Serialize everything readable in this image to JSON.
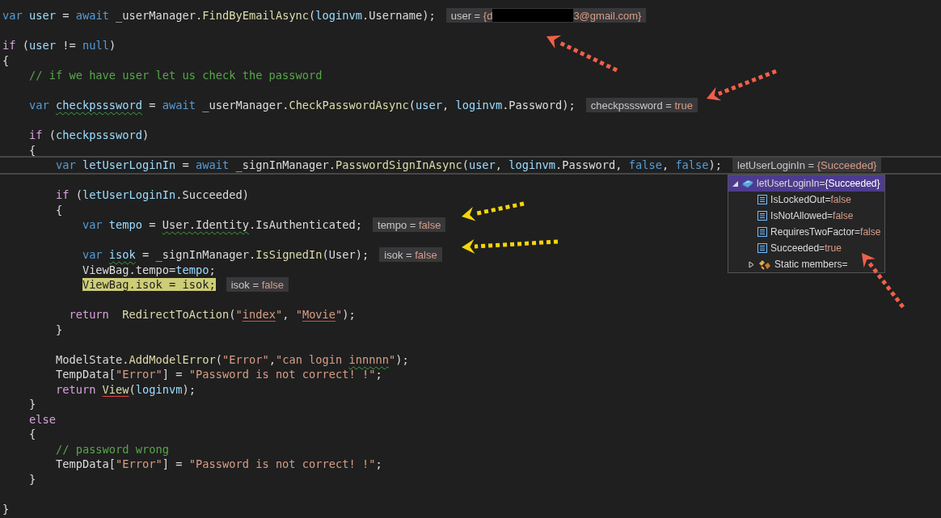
{
  "lines": [
    {
      "kind": "code",
      "tokens": [
        {
          "t": "var ",
          "kind": "kw"
        },
        {
          "t": "user",
          "kind": "var"
        },
        {
          "t": " = ",
          "kind": "txt"
        },
        {
          "t": "await",
          "kind": "kw"
        },
        {
          "t": " _userManager.",
          "kind": "txt"
        },
        {
          "t": "FindByEmailAsync",
          "kind": "fn"
        },
        {
          "t": "(",
          "kind": "txt"
        },
        {
          "t": "loginvm",
          "kind": "var"
        },
        {
          "t": ".Username);",
          "kind": "txt"
        }
      ],
      "datatip": {
        "label": "user = ",
        "value": "{d",
        "redacted": true,
        "value_end": "3@gmail.com}"
      }
    },
    {
      "kind": "blank"
    },
    {
      "kind": "code",
      "tokens": [
        {
          "t": "if",
          "kind": "ctl"
        },
        {
          "t": " (",
          "kind": "txt"
        },
        {
          "t": "user",
          "kind": "var"
        },
        {
          "t": " != ",
          "kind": "txt"
        },
        {
          "t": "null",
          "kind": "kw"
        },
        {
          "t": ")",
          "kind": "txt"
        }
      ]
    },
    {
      "kind": "code",
      "tokens": [
        {
          "t": "{",
          "kind": "txt"
        }
      ]
    },
    {
      "kind": "code",
      "tokens": [
        {
          "t": "    // if we have user let us check the password",
          "kind": "cmt"
        }
      ]
    },
    {
      "kind": "blank"
    },
    {
      "kind": "code",
      "tokens": [
        {
          "t": "    var ",
          "kind": "kw"
        },
        {
          "t": "checkpsssword",
          "kind": "var",
          "warning": true
        },
        {
          "t": " = ",
          "kind": "txt"
        },
        {
          "t": "await",
          "kind": "kw"
        },
        {
          "t": " _userManager.",
          "kind": "txt"
        },
        {
          "t": "CheckPasswordAsync",
          "kind": "fn"
        },
        {
          "t": "(",
          "kind": "txt"
        },
        {
          "t": "user",
          "kind": "var"
        },
        {
          "t": ", ",
          "kind": "txt"
        },
        {
          "t": "loginvm",
          "kind": "var"
        },
        {
          "t": ".Password);",
          "kind": "txt"
        }
      ],
      "datatip": {
        "label": "checkpsssword = ",
        "value": "true"
      }
    },
    {
      "kind": "blank"
    },
    {
      "kind": "code",
      "tokens": [
        {
          "t": "    if",
          "kind": "ctl"
        },
        {
          "t": " (",
          "kind": "txt"
        },
        {
          "t": "checkpsssword",
          "kind": "var"
        },
        {
          "t": ")",
          "kind": "txt"
        }
      ]
    },
    {
      "kind": "code",
      "tokens": [
        {
          "t": "    {",
          "kind": "txt"
        }
      ]
    },
    {
      "kind": "code",
      "current": true,
      "tokens": [
        {
          "t": "        var ",
          "kind": "kw"
        },
        {
          "t": "letUserLoginIn",
          "kind": "var"
        },
        {
          "t": " = ",
          "kind": "txt"
        },
        {
          "t": "await",
          "kind": "kw"
        },
        {
          "t": " _signInManager.",
          "kind": "txt"
        },
        {
          "t": "PasswordSignInAsync",
          "kind": "fn"
        },
        {
          "t": "(",
          "kind": "txt"
        },
        {
          "t": "user",
          "kind": "var"
        },
        {
          "t": ", ",
          "kind": "txt"
        },
        {
          "t": "loginvm",
          "kind": "var"
        },
        {
          "t": ".Password, ",
          "kind": "txt"
        },
        {
          "t": "false",
          "kind": "kw"
        },
        {
          "t": ", ",
          "kind": "txt"
        },
        {
          "t": "false",
          "kind": "kw"
        },
        {
          "t": ");",
          "kind": "txt"
        }
      ],
      "datatip": {
        "label": "letUserLoginIn = ",
        "value": "{Succeeded}"
      },
      "popup": {
        "label": "letUserLoginIn=",
        "value": "{Succeeded}",
        "selected": true,
        "expanded": true,
        "children": [
          {
            "kind": "property",
            "label": "IsLockedOut=",
            "value": "false"
          },
          {
            "kind": "property",
            "label": "IsNotAllowed=",
            "value": "false"
          },
          {
            "kind": "property",
            "label": "RequiresTwoFactor=",
            "value": "false"
          },
          {
            "kind": "property",
            "label": "Succeeded=",
            "value": "true"
          },
          {
            "kind": "static",
            "label": "Static members=",
            "expanded": false
          }
        ]
      }
    },
    {
      "kind": "blank"
    },
    {
      "kind": "code",
      "tokens": [
        {
          "t": "        if",
          "kind": "ctl"
        },
        {
          "t": " (",
          "kind": "txt"
        },
        {
          "t": "letUserLoginIn",
          "kind": "var"
        },
        {
          "t": ".Succeeded)",
          "kind": "txt"
        }
      ]
    },
    {
      "kind": "code",
      "tokens": [
        {
          "t": "        {",
          "kind": "txt"
        }
      ]
    },
    {
      "kind": "code",
      "tokens": [
        {
          "t": "            var ",
          "kind": "kw"
        },
        {
          "t": "tempo",
          "kind": "var"
        },
        {
          "t": " = ",
          "kind": "txt"
        },
        {
          "t": "User.Identity",
          "kind": "txt",
          "warning": true
        },
        {
          "t": ".IsAuthenticated;",
          "kind": "txt"
        }
      ],
      "datatip": {
        "label": "tempo = ",
        "value": "false"
      }
    },
    {
      "kind": "blank"
    },
    {
      "kind": "code",
      "tokens": [
        {
          "t": "            var ",
          "kind": "kw"
        },
        {
          "t": "isok",
          "kind": "var",
          "warning": true
        },
        {
          "t": " = _signInManager.",
          "kind": "txt"
        },
        {
          "t": "IsSignedIn",
          "kind": "fn"
        },
        {
          "t": "(User);",
          "kind": "txt"
        }
      ],
      "datatip": {
        "label": "isok = ",
        "value": "false"
      }
    },
    {
      "kind": "code",
      "tokens": [
        {
          "t": "            ViewBag.tempo=",
          "kind": "txt"
        },
        {
          "t": "tempo",
          "kind": "var"
        },
        {
          "t": ";",
          "kind": "txt"
        }
      ]
    },
    {
      "kind": "code",
      "tokens": [
        {
          "t": "            ViewBag.isok = isok;",
          "kind": "highlight"
        }
      ],
      "datatip": {
        "label": "isok = ",
        "value": "false"
      }
    },
    {
      "kind": "blank"
    },
    {
      "kind": "code",
      "tokens": [
        {
          "t": "          return",
          "kind": "ctl"
        },
        {
          "t": "  RedirectToAction",
          "kind": "fn"
        },
        {
          "t": "(",
          "kind": "txt"
        },
        {
          "t": "\"",
          "kind": "str"
        },
        {
          "t": "index",
          "kind": "str",
          "error": true
        },
        {
          "t": "\"",
          "kind": "str"
        },
        {
          "t": ", ",
          "kind": "txt"
        },
        {
          "t": "\"",
          "kind": "str"
        },
        {
          "t": "Movie",
          "kind": "str",
          "error": true
        },
        {
          "t": "\"",
          "kind": "str"
        },
        {
          "t": ");",
          "kind": "txt"
        }
      ]
    },
    {
      "kind": "code",
      "tokens": [
        {
          "t": "        }",
          "kind": "txt"
        }
      ]
    },
    {
      "kind": "blank"
    },
    {
      "kind": "code",
      "tokens": [
        {
          "t": "        ModelState.",
          "kind": "txt"
        },
        {
          "t": "AddModelError",
          "kind": "fn"
        },
        {
          "t": "(",
          "kind": "txt"
        },
        {
          "t": "\"Error\"",
          "kind": "str"
        },
        {
          "t": ",",
          "kind": "txt"
        },
        {
          "t": "\"can login ",
          "kind": "str"
        },
        {
          "t": "innnnn",
          "kind": "str",
          "warning": true
        },
        {
          "t": "\"",
          "kind": "str"
        },
        {
          "t": ");",
          "kind": "txt"
        }
      ]
    },
    {
      "kind": "code",
      "tokens": [
        {
          "t": "        TempData[",
          "kind": "txt"
        },
        {
          "t": "\"Error\"",
          "kind": "str"
        },
        {
          "t": "] = ",
          "kind": "txt"
        },
        {
          "t": "\"Password is not correct! !\"",
          "kind": "str"
        },
        {
          "t": ";",
          "kind": "txt"
        }
      ]
    },
    {
      "kind": "code",
      "tokens": [
        {
          "t": "        return ",
          "kind": "ctl"
        },
        {
          "t": "View",
          "kind": "fn",
          "error": true
        },
        {
          "t": "(",
          "kind": "txt"
        },
        {
          "t": "loginvm",
          "kind": "var"
        },
        {
          "t": ");",
          "kind": "txt"
        }
      ]
    },
    {
      "kind": "code",
      "tokens": [
        {
          "t": "    }",
          "kind": "txt"
        }
      ]
    },
    {
      "kind": "code",
      "tokens": [
        {
          "t": "    else",
          "kind": "ctl"
        }
      ]
    },
    {
      "kind": "code",
      "tokens": [
        {
          "t": "    {",
          "kind": "txt"
        }
      ]
    },
    {
      "kind": "code",
      "tokens": [
        {
          "t": "        // password wrong",
          "kind": "cmt"
        }
      ]
    },
    {
      "kind": "code",
      "tokens": [
        {
          "t": "        TempData[",
          "kind": "txt"
        },
        {
          "t": "\"Error\"",
          "kind": "str"
        },
        {
          "t": "] = ",
          "kind": "txt"
        },
        {
          "t": "\"Password is not correct! !\"",
          "kind": "str"
        },
        {
          "t": ";",
          "kind": "txt"
        }
      ]
    },
    {
      "kind": "code",
      "tokens": [
        {
          "t": "    }",
          "kind": "txt"
        }
      ]
    },
    {
      "kind": "blank"
    },
    {
      "kind": "code",
      "tokens": [
        {
          "t": "}",
          "kind": "txt"
        }
      ]
    }
  ],
  "arrows": [
    {
      "color": "#f0604a"
    },
    {
      "color": "#f0604a"
    },
    {
      "color": "#f5d60a"
    },
    {
      "color": "#f5d60a"
    },
    {
      "color": "#f0604a"
    }
  ]
}
